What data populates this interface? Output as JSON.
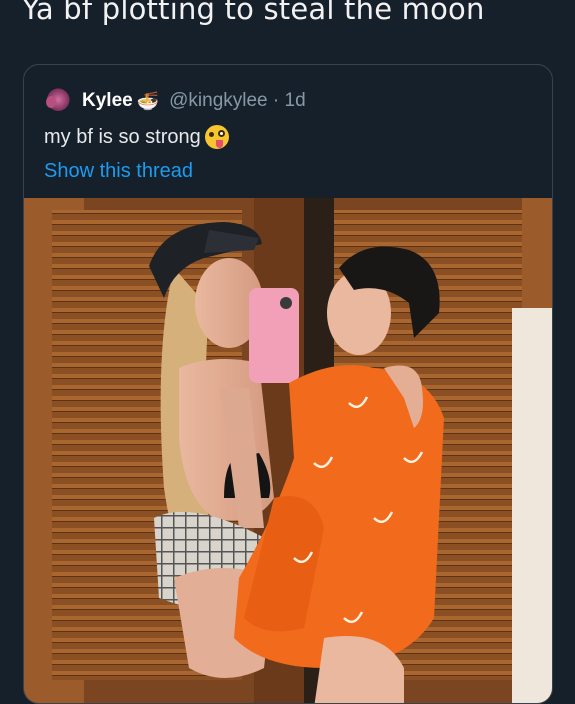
{
  "caption": "Ya bf plotting to steal the moon",
  "quoted_tweet": {
    "display_name": "Kylee",
    "handle_time": "@kingkylee · 1d",
    "text": "my bf is so strong",
    "thread_link": "Show this thread",
    "name_emoji_icon": "ramen-bowl-icon",
    "text_emoji_icon": "zany-face-icon"
  },
  "colors": {
    "background": "#15202b",
    "border": "#38444d",
    "secondary_text": "#8899a6",
    "link": "#1d9bf0",
    "hoodie": "#f26a1b",
    "door_wood": "#9a5a2a"
  }
}
